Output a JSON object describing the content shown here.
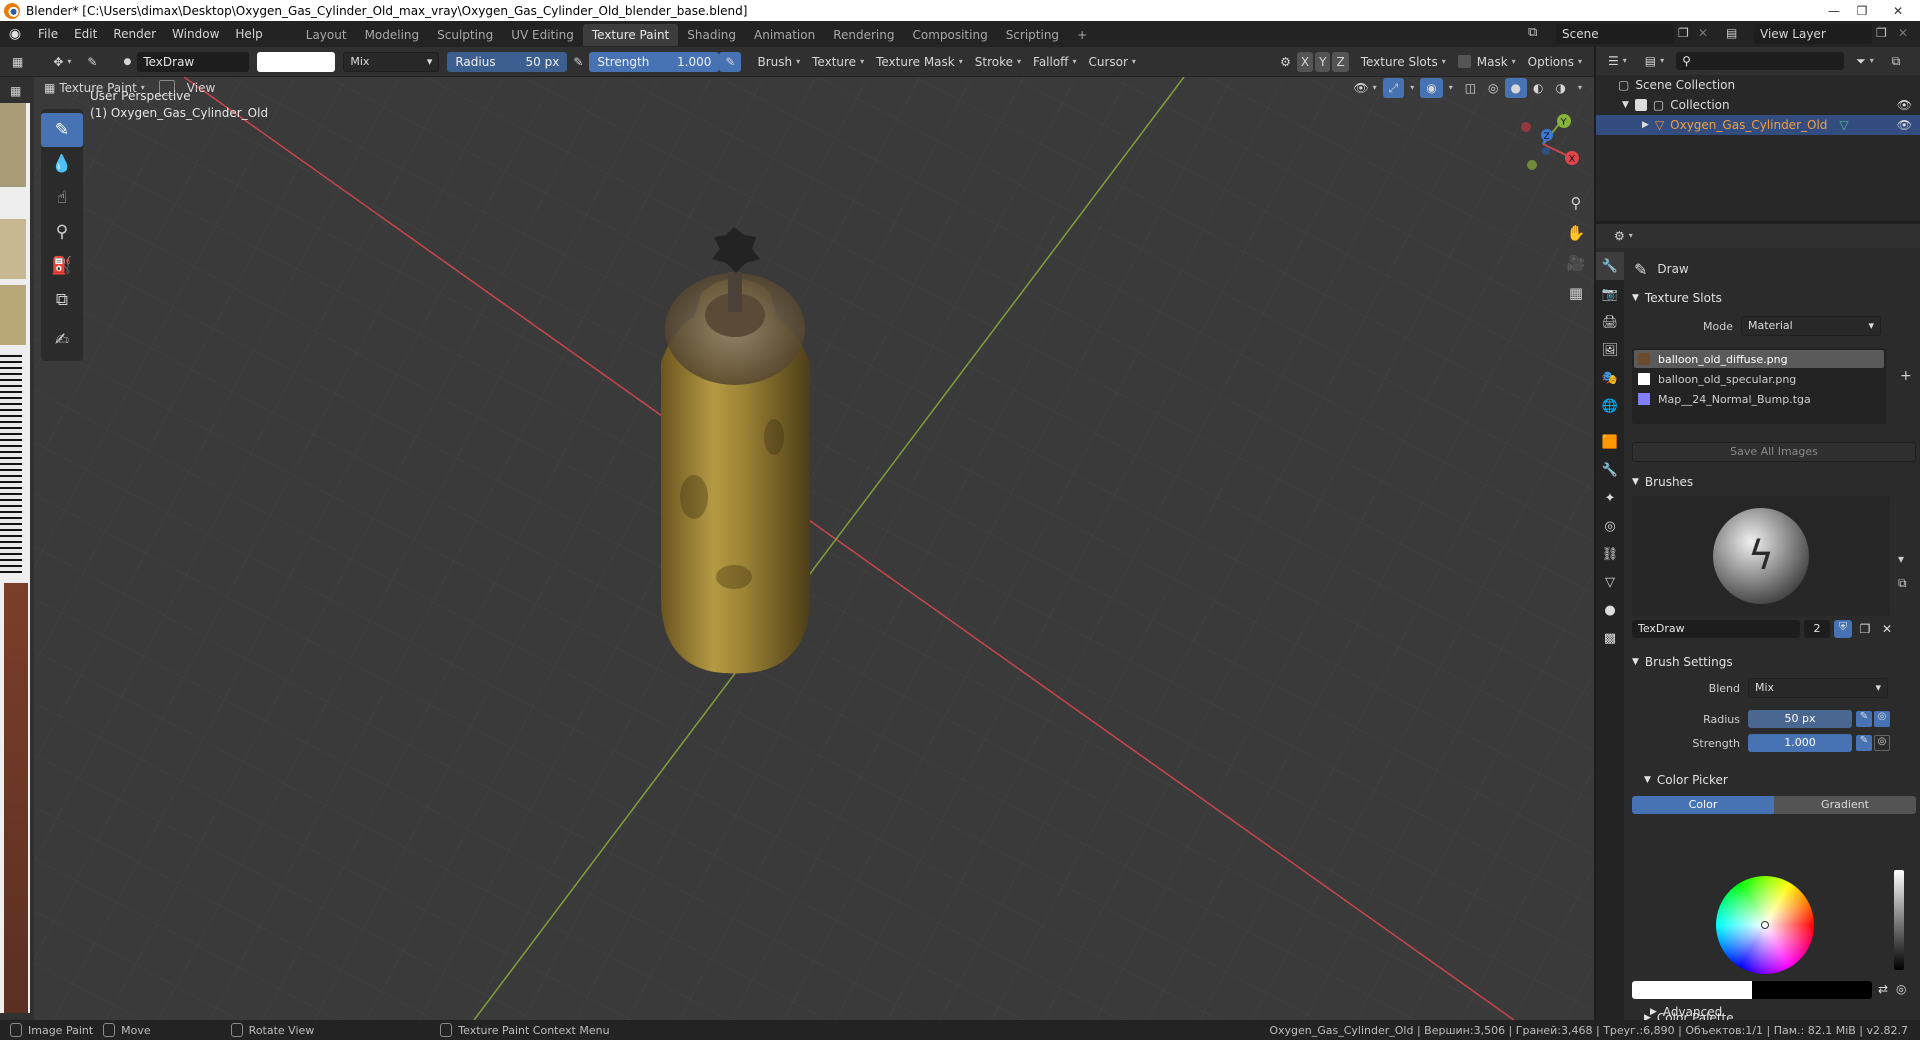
{
  "window": {
    "title": "Blender* [C:\\Users\\dimax\\Desktop\\Oxygen_Gas_Cylinder_Old_max_vray\\Oxygen_Gas_Cylinder_Old_blender_base.blend]",
    "minimize": "—",
    "maximize": "❐",
    "close": "✕"
  },
  "menu": {
    "items": [
      "File",
      "Edit",
      "Render",
      "Window",
      "Help"
    ],
    "workspaces": [
      "Layout",
      "Modeling",
      "Sculpting",
      "UV Editing",
      "Texture Paint",
      "Shading",
      "Animation",
      "Rendering",
      "Compositing",
      "Scripting"
    ],
    "active_workspace": "Texture Paint",
    "add_tab": "+",
    "scene": "Scene",
    "view_layer": "View Layer"
  },
  "tool_header": {
    "brush_name": "TexDraw",
    "blend": "Mix",
    "radius_label": "Radius",
    "radius_value": "50 px",
    "strength_label": "Strength",
    "strength_value": "1.000",
    "menus": [
      "Brush",
      "Texture",
      "Texture Mask",
      "Stroke",
      "Falloff",
      "Cursor"
    ],
    "axes": [
      "X",
      "Y",
      "Z"
    ],
    "texture_slots": "Texture Slots",
    "mask": "Mask",
    "options": "Options"
  },
  "viewport": {
    "mode": "Texture Paint",
    "view_menu": "View",
    "perspective": "User Perspective",
    "object_label": "(1) Oxygen_Gas_Cylinder_Old",
    "gizmo_axes": [
      "X",
      "Y",
      "Z"
    ]
  },
  "outliner": {
    "root": "Scene Collection",
    "collection": "Collection",
    "object": "Oxygen_Gas_Cylinder_Old"
  },
  "properties": {
    "tool_name": "Draw",
    "texture_slots_title": "Texture Slots",
    "mode_label": "Mode",
    "mode_value": "Material",
    "slots": [
      {
        "name": "balloon_old_diffuse.png",
        "swatch": "#6b4a2e",
        "selected": true
      },
      {
        "name": "balloon_old_specular.png",
        "swatch": "#ffffff",
        "selected": false
      },
      {
        "name": "Map__24_Normal_Bump.tga",
        "swatch": "#8080ff",
        "selected": false
      }
    ],
    "save_all": "Save All Images",
    "brushes_title": "Brushes",
    "brush_name": "TexDraw",
    "brush_users": "2",
    "brush_settings_title": "Brush Settings",
    "blend_label": "Blend",
    "blend_value": "Mix",
    "radius_label": "Radius",
    "radius_value": "50 px",
    "strength_label": "Strength",
    "strength_value": "1.000",
    "color_picker_title": "Color Picker",
    "color_tab": "Color",
    "gradient_tab": "Gradient",
    "color_palette": "Color Palette",
    "advanced": "Advanced"
  },
  "statusbar": {
    "left": [
      {
        "key": "mouse-left",
        "label": "Image Paint"
      },
      {
        "key": "mouse-drag",
        "label": "Move"
      },
      {
        "key": "mouse-middle",
        "label": "Rotate View"
      },
      {
        "key": "mouse-right",
        "label": "Texture Paint Context Menu"
      }
    ],
    "stats": "Oxygen_Gas_Cylinder_Old | Вершин:3,506 | Граней:3,468 | Треуг.:6,890 | Объектов:1/1 | Пам.: 82.1 MiB | v2.82.7"
  },
  "colors": {
    "accent": "#4772b3",
    "header": "#303030",
    "viewport_bg": "#3a3a3a",
    "x_axis": "#c8464b",
    "y_axis": "#7fa13a"
  }
}
